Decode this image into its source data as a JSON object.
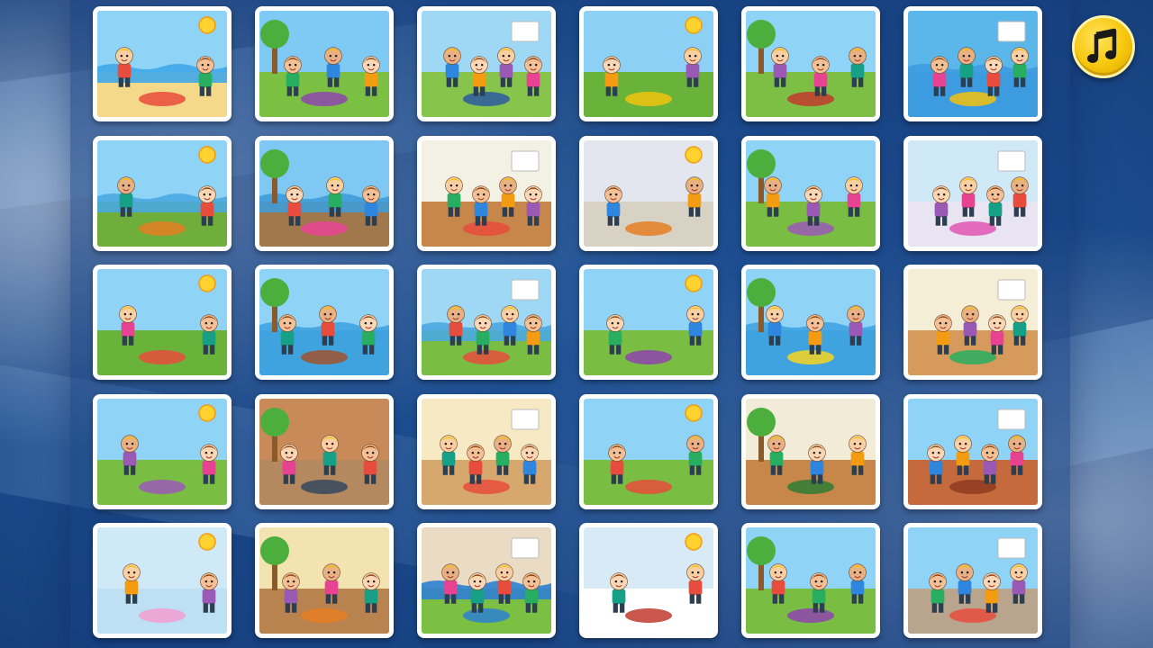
{
  "app": {
    "screen": "scene-selection"
  },
  "colors": {
    "background": "#1d4f92",
    "card_border": "#ffffff",
    "music_button": "#f6c60c"
  },
  "music_button": {
    "icon": "music-note-icon",
    "state": "on"
  },
  "scenes": [
    {
      "id": "beach",
      "sky": "#8fd3f7",
      "ground": "#f4d98a",
      "accent": "#e94b3c",
      "water": "#3fa9e8"
    },
    {
      "id": "picnic-blocks",
      "sky": "#7fcaf4",
      "ground": "#7bc043",
      "accent": "#8e44ad",
      "water": ""
    },
    {
      "id": "park-policeman",
      "sky": "#9ed8f5",
      "ground": "#86c44c",
      "accent": "#2c5aa0",
      "water": ""
    },
    {
      "id": "winners-podium",
      "sky": "#8dd0f6",
      "ground": "#6ab33a",
      "accent": "#f1c40f",
      "water": ""
    },
    {
      "id": "apple-orchard",
      "sky": "#8fd3f7",
      "ground": "#7dbf45",
      "accent": "#c0392b",
      "water": ""
    },
    {
      "id": "swim-ring",
      "sky": "#5bb7ea",
      "ground": "#3d9be0",
      "accent": "#f4c20d",
      "water": "#3d9be0"
    },
    {
      "id": "camping-river",
      "sky": "#8fd3f7",
      "ground": "#6fae3b",
      "accent": "#e67e22",
      "water": "#4aa8e0"
    },
    {
      "id": "dock-friends",
      "sky": "#7ec8f3",
      "ground": "#a0784b",
      "accent": "#e84393",
      "water": "#3f9bd8"
    },
    {
      "id": "gym-class",
      "sky": "#f3f0e4",
      "ground": "#c8874a",
      "accent": "#e74c3c",
      "water": ""
    },
    {
      "id": "nursery-room",
      "sky": "#e3e6ef",
      "ground": "#d8d2c5",
      "accent": "#e67e22",
      "water": ""
    },
    {
      "id": "field-play",
      "sky": "#8fd3f7",
      "ground": "#79bd43",
      "accent": "#9b59b6",
      "water": ""
    },
    {
      "id": "baby-bath",
      "sky": "#cfe9f7",
      "ground": "#e8e4f2",
      "accent": "#e056b5",
      "water": ""
    },
    {
      "id": "tractor-ride",
      "sky": "#8fd3f7",
      "ground": "#6ab33a",
      "accent": "#e74c3c",
      "water": ""
    },
    {
      "id": "rowing-boat",
      "sky": "#8fd3f7",
      "ground": "#3fa3e0",
      "accent": "#a0522d",
      "water": "#3fa3e0"
    },
    {
      "id": "river-swim",
      "sky": "#9fd8f5",
      "ground": "#79bd43",
      "accent": "#e74c3c",
      "water": "#4aa8e0"
    },
    {
      "id": "campsite",
      "sky": "#8fd3f7",
      "ground": "#79bd43",
      "accent": "#8e44ad",
      "water": ""
    },
    {
      "id": "banana-boat",
      "sky": "#8fd3f7",
      "ground": "#3fa3e0",
      "accent": "#f7d51d",
      "water": "#3fa3e0"
    },
    {
      "id": "classroom",
      "sky": "#f4eed7",
      "ground": "#d69b5c",
      "accent": "#27ae60",
      "water": ""
    },
    {
      "id": "jump-rope",
      "sky": "#8fd3f7",
      "ground": "#79bd43",
      "accent": "#9b59b6",
      "water": ""
    },
    {
      "id": "western-town",
      "sky": "#c98a5a",
      "ground": "#b58960",
      "accent": "#34495e",
      "water": ""
    },
    {
      "id": "sewing-machine",
      "sky": "#f6e9c4",
      "ground": "#d7a86e",
      "accent": "#e74c3c",
      "water": ""
    },
    {
      "id": "circus-fair",
      "sky": "#8fd3f7",
      "ground": "#79bd43",
      "accent": "#e74c3c",
      "water": ""
    },
    {
      "id": "school-desk",
      "sky": "#f2ebd7",
      "ground": "#c8874a",
      "accent": "#2e7d32",
      "water": ""
    },
    {
      "id": "canyon-west",
      "sky": "#8fd3f7",
      "ground": "#c56a3d",
      "accent": "#8e3b1f",
      "water": ""
    },
    {
      "id": "crawling-baby",
      "sky": "#cfe9f7",
      "ground": "#bde0f5",
      "accent": "#f39ccf",
      "water": ""
    },
    {
      "id": "fireplace-room",
      "sky": "#f3e3b0",
      "ground": "#b8834f",
      "accent": "#e67e22",
      "water": ""
    },
    {
      "id": "paddling-pool",
      "sky": "#eadcc4",
      "ground": "#7bc043",
      "accent": "#2d7fd1",
      "water": "#2d7fd1"
    },
    {
      "id": "winter-snow",
      "sky": "#d9eaf7",
      "ground": "#ffffff",
      "accent": "#c0392b",
      "water": ""
    },
    {
      "id": "archery",
      "sky": "#8fd3f7",
      "ground": "#79bd43",
      "accent": "#8e44ad",
      "water": ""
    },
    {
      "id": "firefighters-town",
      "sky": "#8fd3f7",
      "ground": "#b9a48d",
      "accent": "#e74c3c",
      "water": ""
    }
  ]
}
